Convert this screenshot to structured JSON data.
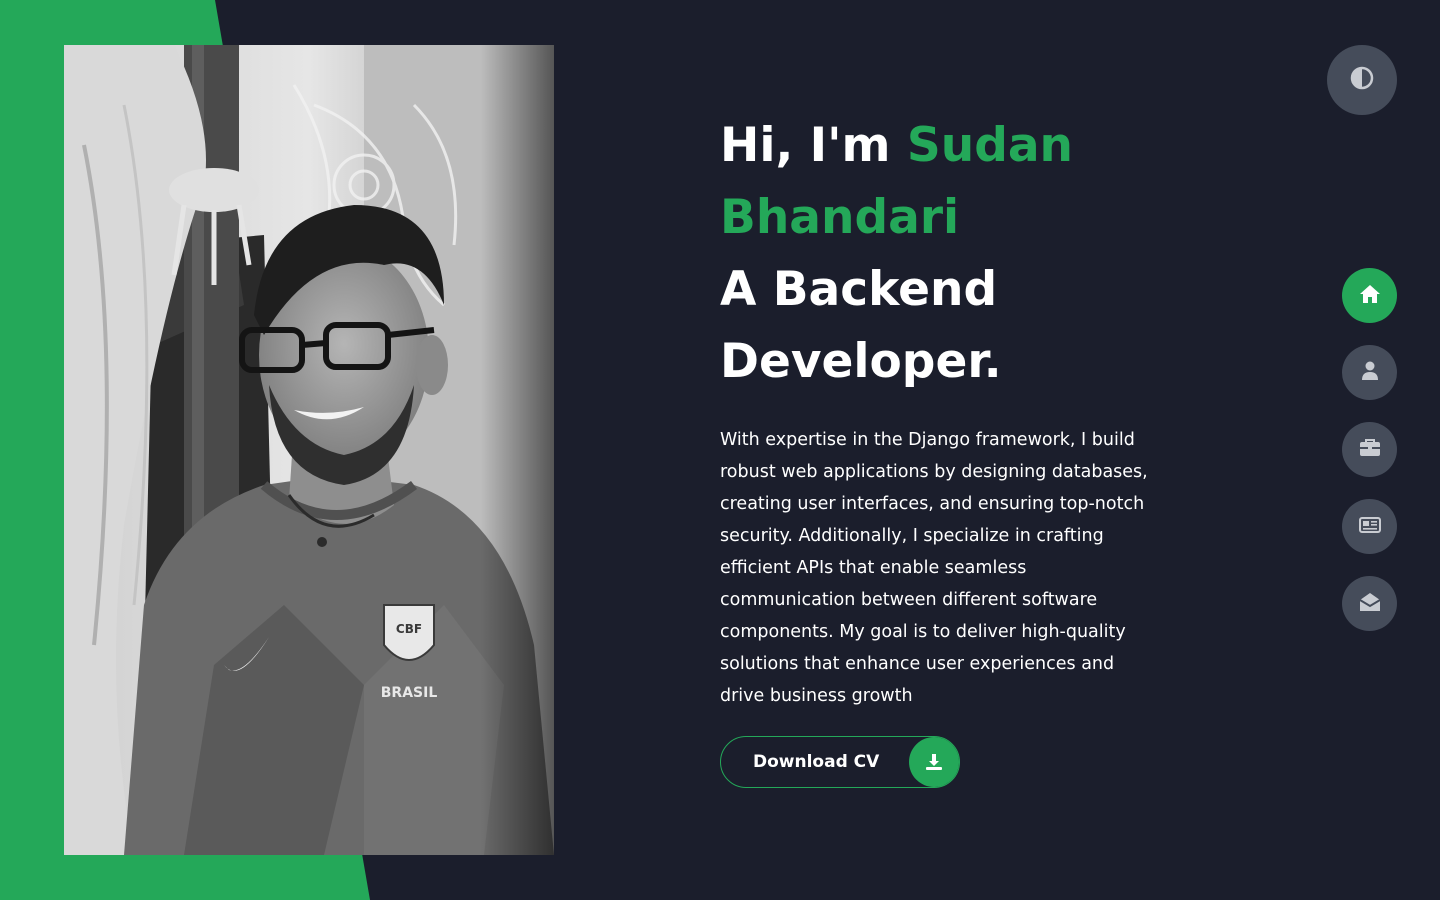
{
  "colors": {
    "accent": "#24a859",
    "background": "#1b1e2c",
    "button_gray": "#454c5a",
    "text": "#ffffff"
  },
  "hero": {
    "greeting": "Hi, I'm ",
    "first_name": "Sudan",
    "last_name": "Bhandari",
    "role_line1": "A Backend",
    "role_line2": "Developer.",
    "description": "With expertise in the Django framework, I build robust web applications by designing databases, creating user interfaces, and ensuring top-notch security. Additionally, I specialize in crafting efficient APIs that enable seamless communication between different software components. My goal is to deliver high-quality solutions that enhance user experiences and drive business growth"
  },
  "cv_button": {
    "label": "Download CV",
    "icon": "download-icon"
  },
  "theme_toggle": {
    "icon": "contrast-icon"
  },
  "nav": {
    "items": [
      {
        "name": "home",
        "icon": "home-icon",
        "active": true
      },
      {
        "name": "about",
        "icon": "user-icon",
        "active": false
      },
      {
        "name": "portfolio",
        "icon": "briefcase-icon",
        "active": false
      },
      {
        "name": "blog",
        "icon": "newspaper-icon",
        "active": false
      },
      {
        "name": "contact",
        "icon": "envelope-open-icon",
        "active": false
      }
    ]
  },
  "photo": {
    "subject": "portrait-photo"
  }
}
